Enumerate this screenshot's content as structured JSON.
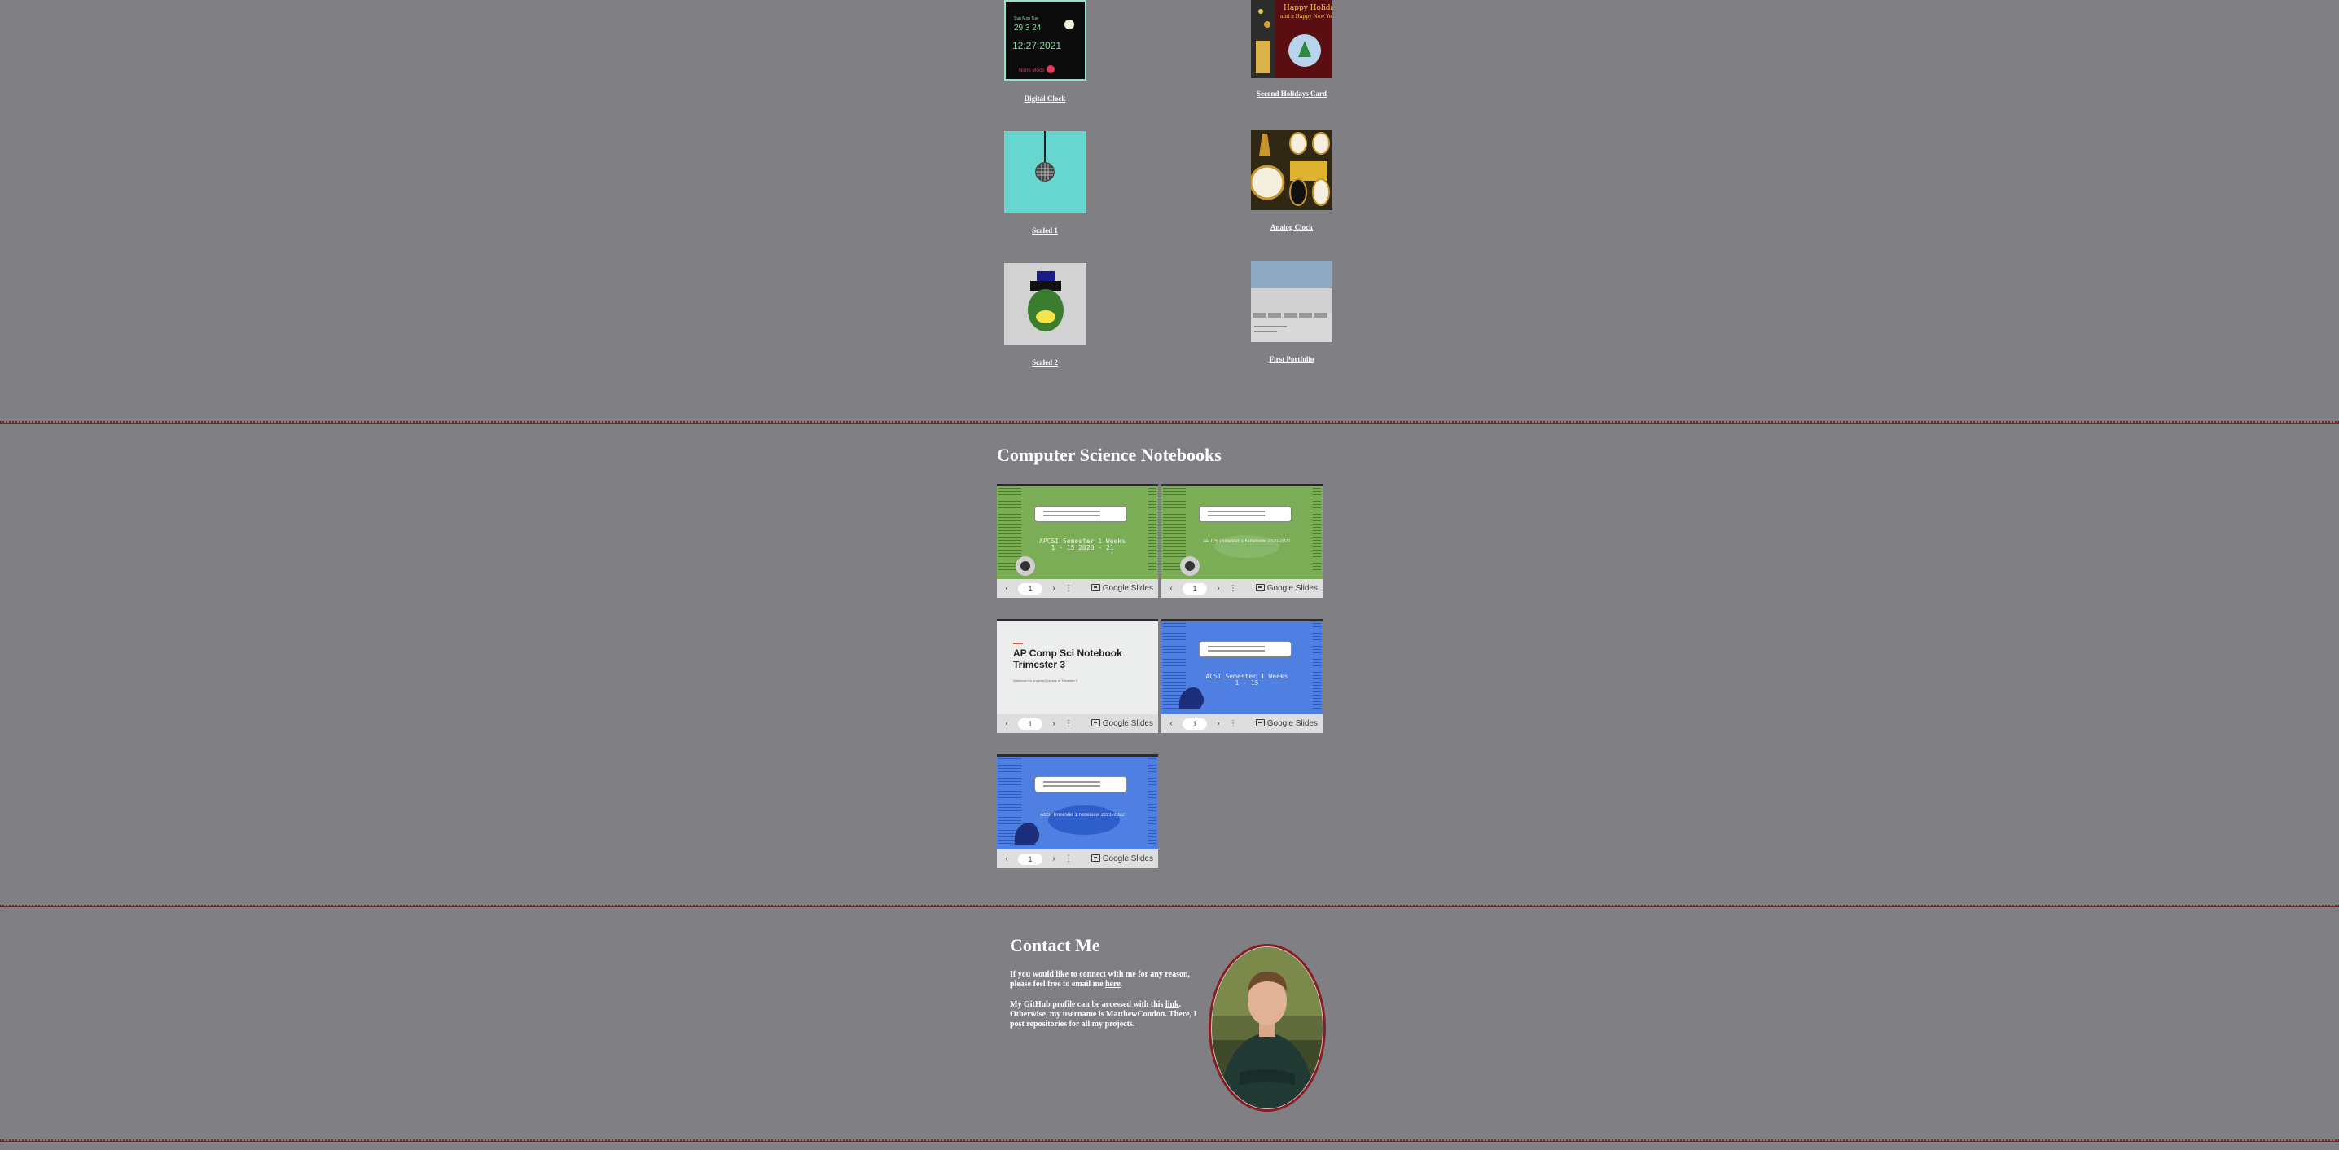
{
  "projects": [
    {
      "title": "Digital Clock",
      "preview": {
        "day": "29",
        "time": "12:27:2021",
        "am": "AM"
      }
    },
    {
      "title": "Second Holidays Card",
      "preview": {
        "line1": "Happy Holidays",
        "line2": "and a Happy New Year!"
      }
    },
    {
      "title": "Scaled 1"
    },
    {
      "title": "Analog Clock"
    },
    {
      "title": "Scaled 2"
    },
    {
      "title": "First Portfolio"
    }
  ],
  "notebooks": {
    "title": "Computer Science Notebooks",
    "embeds": [
      {
        "theme": "green",
        "slide_text": "APCSI Semester 1 Weeks 1 - 15 2020 - 21",
        "page": "1",
        "provider": "Google Slides"
      },
      {
        "theme": "green",
        "slide_text": "AP CS Trimester 1 Notebook 2020-2021",
        "page": "1",
        "provider": "Google Slides"
      },
      {
        "theme": "white",
        "slide_text": "AP Comp Sci Notebook Trimester 3",
        "subtitle": "Notebook for projects/Quizzes of Trimester 3",
        "page": "1",
        "provider": "Google Slides"
      },
      {
        "theme": "blue",
        "slide_text": "ACSI Semester 1 Weeks 1 - 15",
        "page": "1",
        "provider": "Google Slides"
      },
      {
        "theme": "blue",
        "slide_text": "ACSI Trimester 1 Notebook 2021-2022",
        "page": "1",
        "provider": "Google Slides"
      }
    ],
    "controls": {
      "prev": "‹",
      "next": "›",
      "more": "⋮"
    }
  },
  "contact": {
    "title": "Contact Me",
    "p1_before": "If you would like to connect with me for any reason, please feel free to email me ",
    "p1_link": "here",
    "p1_after": ".",
    "p2_before": "My GitHub profile can be accessed with this ",
    "p2_link": "link",
    "p2_after": ". Otherwise, my username is MatthewCondon. There, I post repositories for all my projects.",
    "photo_alt": "profile photo"
  },
  "colors": {
    "page_bg": "#807f84",
    "divider": "#9a1c22",
    "notebook_green": "#7aad56",
    "notebook_blue": "#4f7fe0",
    "photo_ring": "#8b1c24"
  }
}
